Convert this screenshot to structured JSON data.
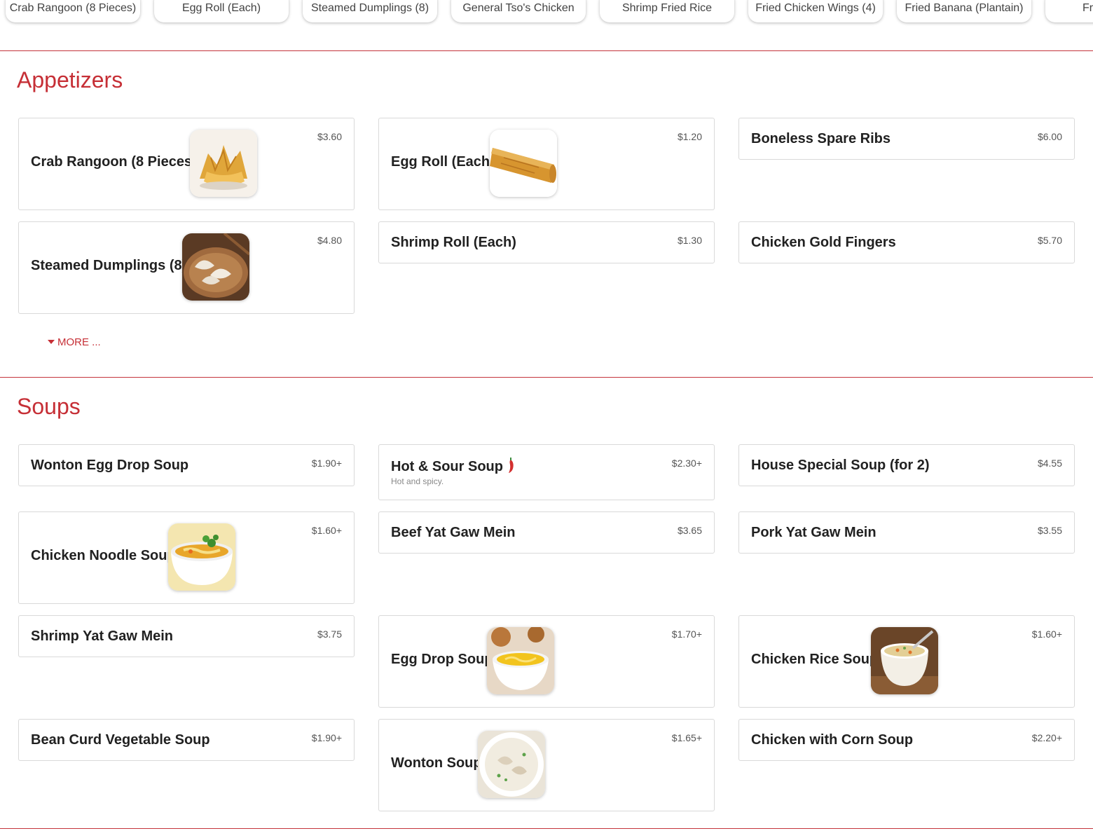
{
  "popular_items": [
    "Crab Rangoon (8 Pieces)",
    "Egg Roll (Each)",
    "Steamed Dumplings (8)",
    "General Tso's Chicken",
    "Shrimp Fried Rice",
    "Fried Chicken Wings (4)",
    "Fried Banana (Plantain)",
    "Fre"
  ],
  "sections": {
    "appetizers": {
      "title": "Appetizers",
      "more_label": "MORE ...",
      "items": [
        {
          "name": "Crab Rangoon (8 Pieces)",
          "price": "$3.60",
          "image": "crab-rangoon"
        },
        {
          "name": "Egg Roll (Each)",
          "price": "$1.20",
          "image": "egg-roll"
        },
        {
          "name": "Boneless Spare Ribs",
          "price": "$6.00"
        },
        {
          "name": "Steamed Dumplings (8)",
          "price": "$4.80",
          "image": "dumplings"
        },
        {
          "name": "Shrimp Roll (Each)",
          "price": "$1.30"
        },
        {
          "name": "Chicken Gold Fingers",
          "price": "$5.70"
        }
      ]
    },
    "soups": {
      "title": "Soups",
      "items": [
        {
          "name": "Wonton Egg Drop Soup",
          "price": "$1.90+"
        },
        {
          "name": "Hot & Sour Soup",
          "price": "$2.30+",
          "description": "Hot and spicy.",
          "spicy": true
        },
        {
          "name": "House Special Soup (for 2)",
          "price": "$4.55"
        },
        {
          "name": "Chicken Noodle Soup",
          "price": "$1.60+",
          "image": "chicken-noodle-soup"
        },
        {
          "name": "Beef Yat Gaw Mein",
          "price": "$3.65"
        },
        {
          "name": "Pork Yat Gaw Mein",
          "price": "$3.55"
        },
        {
          "name": "Shrimp Yat Gaw Mein",
          "price": "$3.75"
        },
        {
          "name": "Egg Drop Soup",
          "price": "$1.70+",
          "image": "egg-drop-soup"
        },
        {
          "name": "Chicken Rice Soup",
          "price": "$1.60+",
          "image": "chicken-rice-soup"
        },
        {
          "name": "Bean Curd Vegetable Soup",
          "price": "$1.90+"
        },
        {
          "name": "Wonton Soup",
          "price": "$1.65+",
          "image": "wonton-soup"
        },
        {
          "name": "Chicken with Corn Soup",
          "price": "$2.20+"
        }
      ]
    }
  },
  "colors": {
    "accent": "#c62f36",
    "divider": "#c4343b",
    "card_border": "#d9d9d9"
  }
}
